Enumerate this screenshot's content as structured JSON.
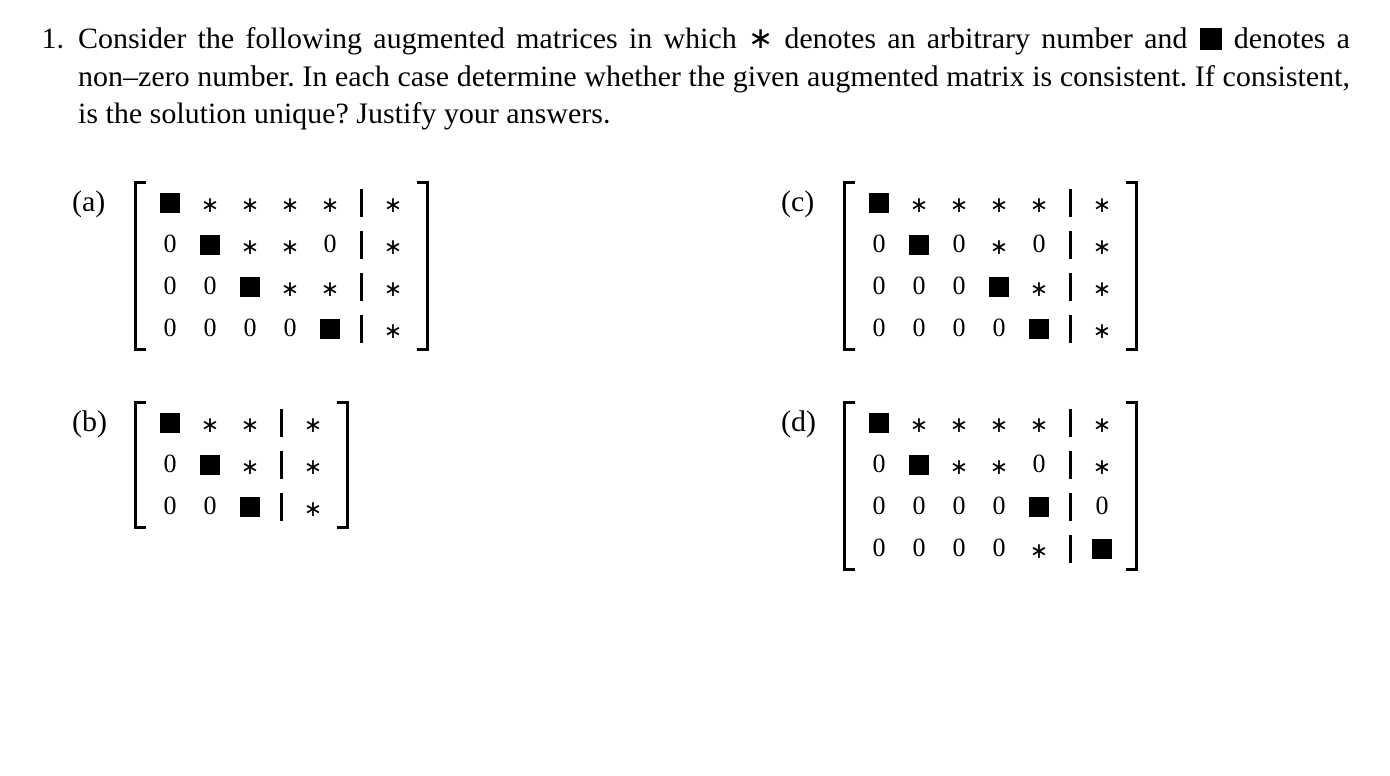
{
  "problem_number": "1.",
  "stem_parts": {
    "t1": "Consider the following augmented matrices in which ",
    "star": "∗",
    "t2": " denotes an arbitrary number and ",
    "t3": " denotes a non–zero number. In each case determine whether the given augmented matrix is consistent. If consistent, is the solution unique? Justify your answers."
  },
  "sub_labels": {
    "a": "(a)",
    "b": "(b)",
    "c": "(c)",
    "d": "(d)"
  },
  "symbols": {
    "zero": "0",
    "star": "∗"
  },
  "chart_data": [
    {
      "label": "(a)",
      "type": "augmented_matrix",
      "rows": 4,
      "cols": 5,
      "aug_cols": 1,
      "entries": [
        [
          "box",
          "*",
          "*",
          "*",
          "*",
          "*"
        ],
        [
          "0",
          "box",
          "*",
          "*",
          "0",
          "*"
        ],
        [
          "0",
          "0",
          "box",
          "*",
          "*",
          "*"
        ],
        [
          "0",
          "0",
          "0",
          "0",
          "box",
          "*"
        ]
      ]
    },
    {
      "label": "(b)",
      "type": "augmented_matrix",
      "rows": 3,
      "cols": 3,
      "aug_cols": 1,
      "entries": [
        [
          "box",
          "*",
          "*",
          "*"
        ],
        [
          "0",
          "box",
          "*",
          "*"
        ],
        [
          "0",
          "0",
          "box",
          "*"
        ]
      ]
    },
    {
      "label": "(c)",
      "type": "augmented_matrix",
      "rows": 4,
      "cols": 5,
      "aug_cols": 1,
      "entries": [
        [
          "box",
          "*",
          "*",
          "*",
          "*",
          "*"
        ],
        [
          "0",
          "box",
          "0",
          "*",
          "0",
          "*"
        ],
        [
          "0",
          "0",
          "0",
          "box",
          "*",
          "*"
        ],
        [
          "0",
          "0",
          "0",
          "0",
          "box",
          "*"
        ]
      ]
    },
    {
      "label": "(d)",
      "type": "augmented_matrix",
      "rows": 4,
      "cols": 5,
      "aug_cols": 1,
      "entries": [
        [
          "box",
          "*",
          "*",
          "*",
          "*",
          "*"
        ],
        [
          "0",
          "box",
          "*",
          "*",
          "0",
          "*"
        ],
        [
          "0",
          "0",
          "0",
          "0",
          "box",
          "0"
        ],
        [
          "0",
          "0",
          "0",
          "0",
          "*",
          "box"
        ]
      ]
    }
  ]
}
